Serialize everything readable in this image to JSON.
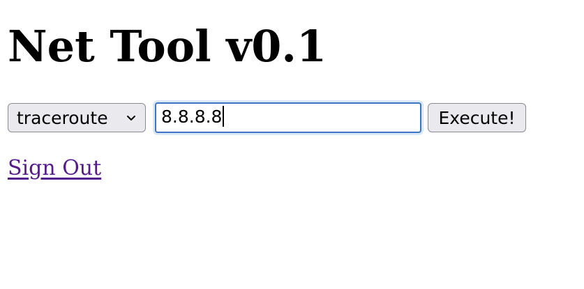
{
  "page": {
    "title": "Net Tool v0.1"
  },
  "form": {
    "command_selected": "traceroute",
    "target_value": "8.8.8.8",
    "submit_label": "Execute!"
  },
  "nav": {
    "sign_out_label": "Sign Out"
  },
  "colors": {
    "link_visited": "#551a8b",
    "focus_border": "#3a76c4",
    "focus_ring": "#d8e6f5",
    "control_bg": "#e9e9ee"
  },
  "icons": {
    "select_arrow": "chevron-down-icon"
  }
}
